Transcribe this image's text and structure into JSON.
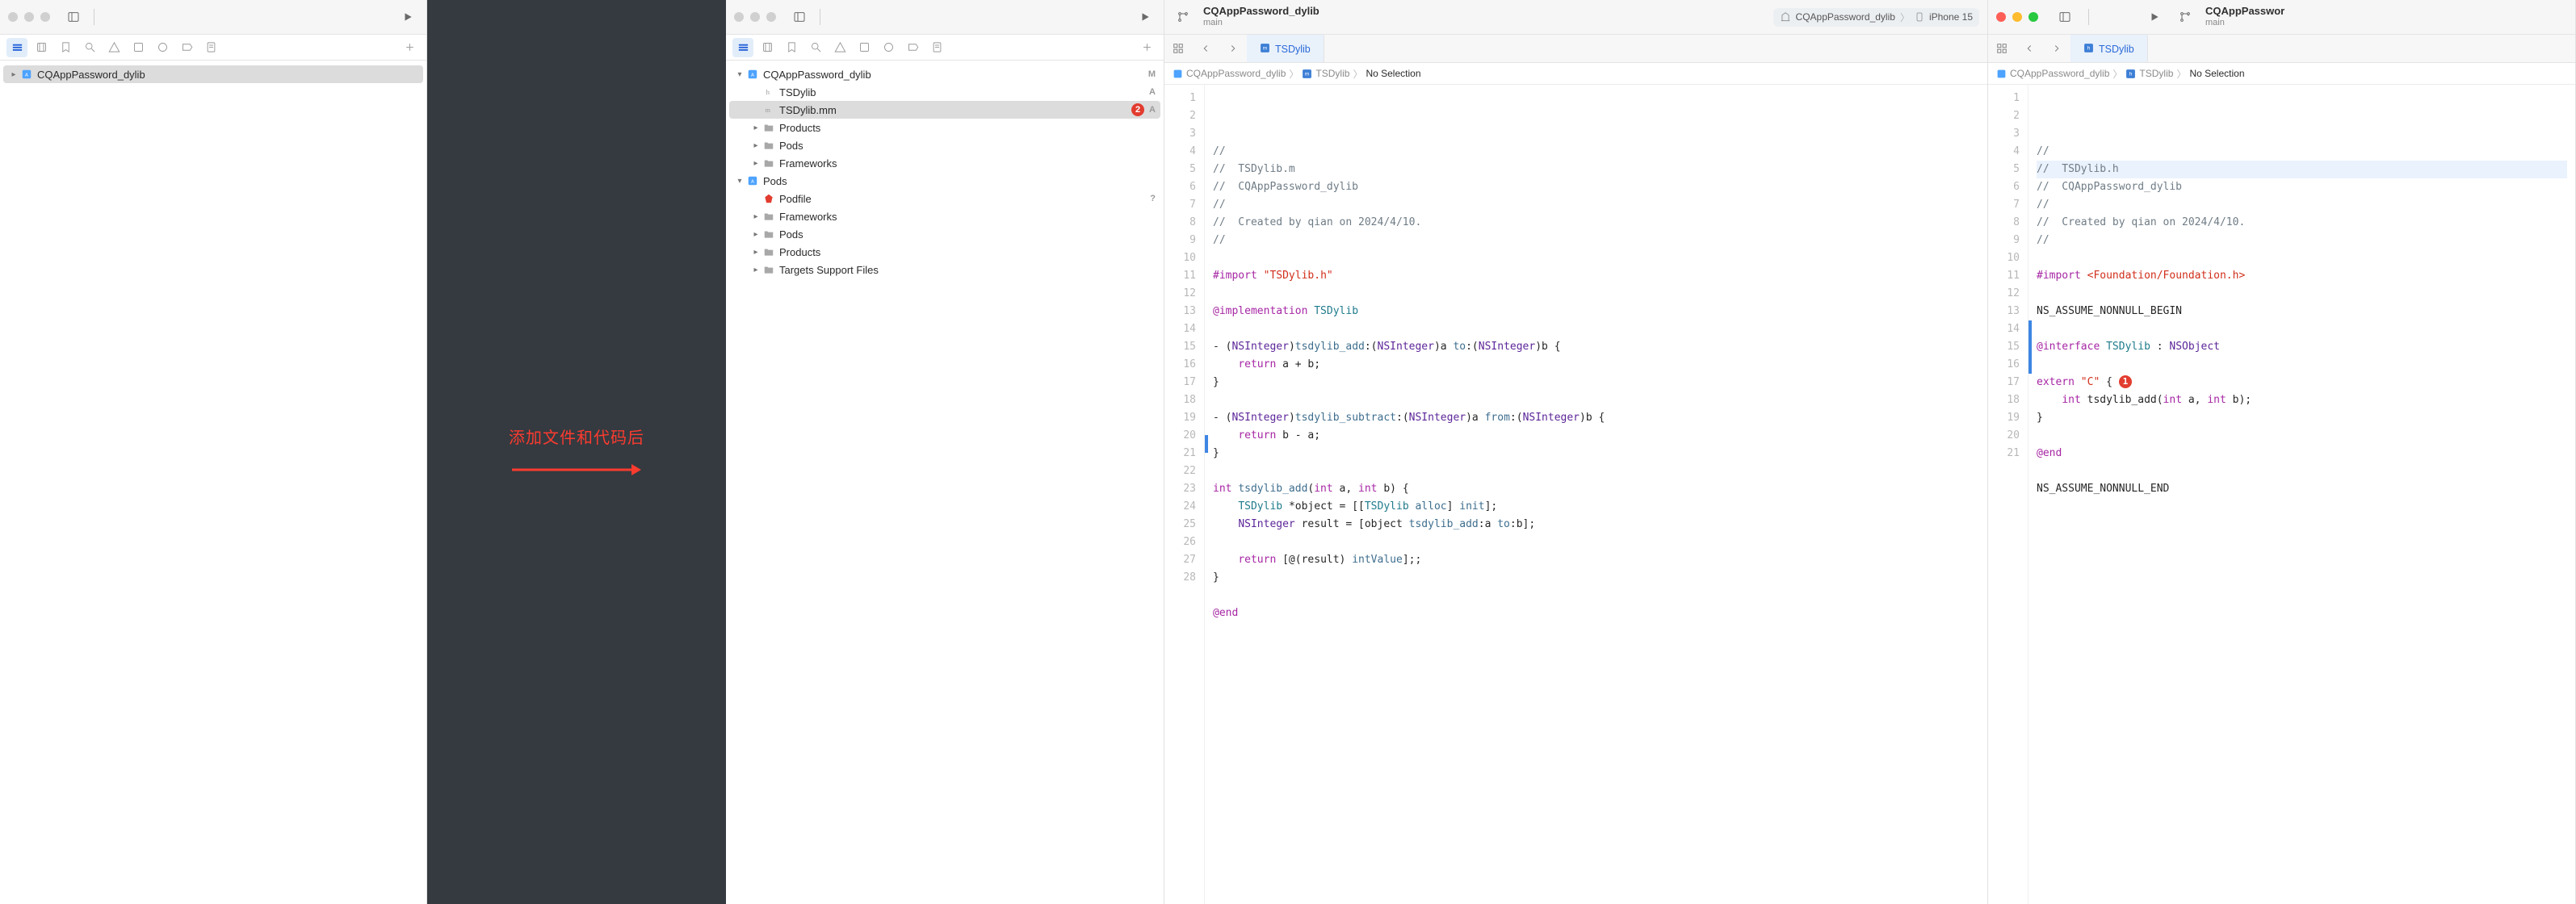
{
  "annotation": {
    "text": "添加文件和代码后"
  },
  "pane1": {
    "navigator": {
      "project": "CQAppPassword_dylib"
    }
  },
  "pane3": {
    "toolbar": {
      "title": "CQAppPassword_dylib",
      "branch": "main",
      "scheme_target": "CQAppPassword_dylib",
      "scheme_device": "iPhone 15"
    },
    "nav": {
      "items": [
        {
          "label": "CQAppPassword_dylib",
          "icon": "project",
          "status": "M",
          "depth": 0,
          "open": true
        },
        {
          "label": "TSDylib",
          "icon": "h",
          "status": "A",
          "depth": 1
        },
        {
          "label": "TSDylib.mm",
          "icon": "m",
          "status": "A",
          "depth": 1,
          "selected": true,
          "errors": "2"
        },
        {
          "label": "Products",
          "icon": "folder",
          "depth": 1,
          "closed": true
        },
        {
          "label": "Pods",
          "icon": "folder",
          "depth": 1,
          "closed": true
        },
        {
          "label": "Frameworks",
          "icon": "folder",
          "depth": 1,
          "closed": true
        },
        {
          "label": "Pods",
          "icon": "project",
          "depth": 0,
          "open": true
        },
        {
          "label": "Podfile",
          "icon": "ruby",
          "depth": 1,
          "q": "?"
        },
        {
          "label": "Frameworks",
          "icon": "folder",
          "depth": 1,
          "closed": true
        },
        {
          "label": "Pods",
          "icon": "folder",
          "depth": 1,
          "closed": true
        },
        {
          "label": "Products",
          "icon": "folder",
          "depth": 1,
          "closed": true
        },
        {
          "label": "Targets Support Files",
          "icon": "folder",
          "depth": 1,
          "closed": true
        }
      ]
    },
    "editor": {
      "tab_label": "TSDylib",
      "breadcrumb": {
        "a": "CQAppPassword_dylib",
        "b": "TSDylib",
        "c": "No Selection"
      },
      "code": [
        {
          "n": 1,
          "html": "<span class='cmt'>//</span>"
        },
        {
          "n": 2,
          "html": "<span class='cmt'>//  TSDylib.m</span>"
        },
        {
          "n": 3,
          "html": "<span class='cmt'>//  CQAppPassword_dylib</span>"
        },
        {
          "n": 4,
          "html": "<span class='cmt'>//</span>"
        },
        {
          "n": 5,
          "html": "<span class='cmt'>//  Created by qian on 2024/4/10.</span>"
        },
        {
          "n": 6,
          "html": "<span class='cmt'>//</span>"
        },
        {
          "n": 7,
          "html": ""
        },
        {
          "n": 8,
          "html": "<span class='kw'>#import</span> <span class='str'>\"TSDylib.h\"</span>"
        },
        {
          "n": 9,
          "html": ""
        },
        {
          "n": 10,
          "html": "<span class='at'>@implementation</span> <span class='cls'>TSDylib</span>"
        },
        {
          "n": 11,
          "html": ""
        },
        {
          "n": 12,
          "html": "<span class='plain'>- (</span><span class='ty'>NSInteger</span><span class='plain'>)</span><span class='fn'>tsdylib_add</span><span class='plain'>:(</span><span class='ty'>NSInteger</span><span class='plain'>)a </span><span class='fn'>to</span><span class='plain'>:(</span><span class='ty'>NSInteger</span><span class='plain'>)b {</span>"
        },
        {
          "n": 13,
          "html": "    <span class='kw'>return</span> <span class='plain'>a + b;</span>"
        },
        {
          "n": 14,
          "html": "<span class='plain'>}</span>"
        },
        {
          "n": 15,
          "html": ""
        },
        {
          "n": 16,
          "html": "<span class='plain'>- (</span><span class='ty'>NSInteger</span><span class='plain'>)</span><span class='fn'>tsdylib_subtract</span><span class='plain'>:(</span><span class='ty'>NSInteger</span><span class='plain'>)a </span><span class='fn'>from</span><span class='plain'>:(</span><span class='ty'>NSInteger</span><span class='plain'>)b {</span>"
        },
        {
          "n": 17,
          "html": "    <span class='kw'>return</span> <span class='plain'>b - a;</span>"
        },
        {
          "n": 18,
          "html": "<span class='plain'>}</span>"
        },
        {
          "n": 19,
          "html": ""
        },
        {
          "n": 20,
          "html": "<span class='kw'>int</span> <span class='fn'>tsdylib_add</span><span class='plain'>(</span><span class='kw'>int</span> <span class='plain'>a, </span><span class='kw'>int</span> <span class='plain'>b) {</span>"
        },
        {
          "n": 21,
          "html": "    <span class='cls'>TSDylib</span> <span class='plain'>*object = [[</span><span class='cls'>TSDylib</span> <span class='fn'>alloc</span><span class='plain'>] </span><span class='fn'>init</span><span class='plain'>];</span>"
        },
        {
          "n": 22,
          "html": "    <span class='ty'>NSInteger</span> <span class='plain'>result = [object </span><span class='fn'>tsdylib_add</span><span class='plain'>:a </span><span class='fn'>to</span><span class='plain'>:b];</span>"
        },
        {
          "n": 23,
          "html": ""
        },
        {
          "n": 24,
          "html": "    <span class='kw'>return</span> <span class='plain'>[@(result) </span><span class='fn'>intValue</span><span class='plain'>];;</span>"
        },
        {
          "n": 25,
          "html": "<span class='plain'>}</span>"
        },
        {
          "n": 26,
          "html": ""
        },
        {
          "n": 27,
          "html": "<span class='at'>@end</span>"
        },
        {
          "n": 28,
          "html": ""
        }
      ]
    }
  },
  "pane4": {
    "toolbar": {
      "title": "CQAppPasswor",
      "branch": "main"
    },
    "editor": {
      "tab_label": "TSDylib",
      "breadcrumb": {
        "a": "CQAppPassword_dylib",
        "b": "TSDylib",
        "c": "No Selection"
      },
      "code": [
        {
          "n": 1,
          "html": "<span class='cmt'>//</span>"
        },
        {
          "n": 2,
          "html": "<span class='cmt'>//  TSDylib.h</span>",
          "hl": true
        },
        {
          "n": 3,
          "html": "<span class='cmt'>//  CQAppPassword_dylib</span>"
        },
        {
          "n": 4,
          "html": "<span class='cmt'>//</span>"
        },
        {
          "n": 5,
          "html": "<span class='cmt'>//  Created by qian on 2024/4/10.</span>"
        },
        {
          "n": 6,
          "html": "<span class='cmt'>//</span>"
        },
        {
          "n": 7,
          "html": ""
        },
        {
          "n": 8,
          "html": "<span class='kw'>#import</span> <span class='str'>&lt;Foundation/Foundation.h&gt;</span>"
        },
        {
          "n": 9,
          "html": ""
        },
        {
          "n": 10,
          "html": "<span class='plain'>NS_ASSUME_NONNULL_BEGIN</span>"
        },
        {
          "n": 11,
          "html": ""
        },
        {
          "n": 12,
          "html": "<span class='at'>@interface</span> <span class='cls'>TSDylib</span> <span class='plain'>: </span><span class='ty'>NSObject</span>"
        },
        {
          "n": 13,
          "html": ""
        },
        {
          "n": 14,
          "html": "<span class='kw'>extern</span> <span class='str'>\"C\"</span> <span class='plain'>{</span>",
          "err": "1"
        },
        {
          "n": 15,
          "html": "    <span class='kw'>int</span> <span class='plain'>tsdylib_add(</span><span class='kw'>int</span> <span class='plain'>a, </span><span class='kw'>int</span> <span class='plain'>b);</span>"
        },
        {
          "n": 16,
          "html": "<span class='plain'>}</span>"
        },
        {
          "n": 17,
          "html": ""
        },
        {
          "n": 18,
          "html": "<span class='at'>@end</span>"
        },
        {
          "n": 19,
          "html": ""
        },
        {
          "n": 20,
          "html": "<span class='plain'>NS_ASSUME_NONNULL_END</span>"
        },
        {
          "n": 21,
          "html": ""
        }
      ]
    }
  }
}
